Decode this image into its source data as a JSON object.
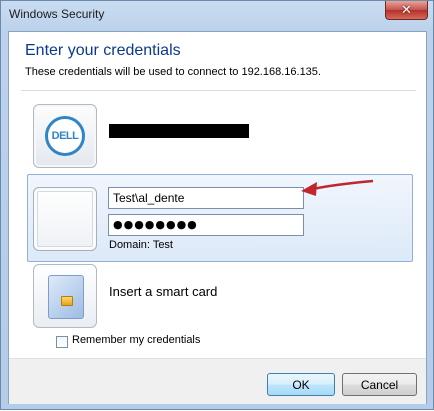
{
  "window": {
    "title": "Windows Security",
    "close_glyph": "✕"
  },
  "dialog": {
    "heading": "Enter your credentials",
    "subheading": "These credentials will be used to connect to 192.168.16.135."
  },
  "tiles": {
    "dell": {
      "logo_text": "DELL",
      "icon": "dell-logo-icon"
    },
    "selected": {
      "username": "Test\\al_dente",
      "password_mask": "●●●●●●●●",
      "domain": "Domain: Test",
      "icon": "user-tile-icon"
    },
    "smart_card": {
      "label": "Insert a smart card",
      "icon": "smart-card-icon"
    }
  },
  "remember": {
    "label": "Remember my credentials",
    "checked": false
  },
  "buttons": {
    "ok": "OK",
    "cancel": "Cancel"
  },
  "colors": {
    "heading": "#0a3a8e",
    "annotation_arrow": "#c0272d",
    "selection": "#dce9f8"
  }
}
